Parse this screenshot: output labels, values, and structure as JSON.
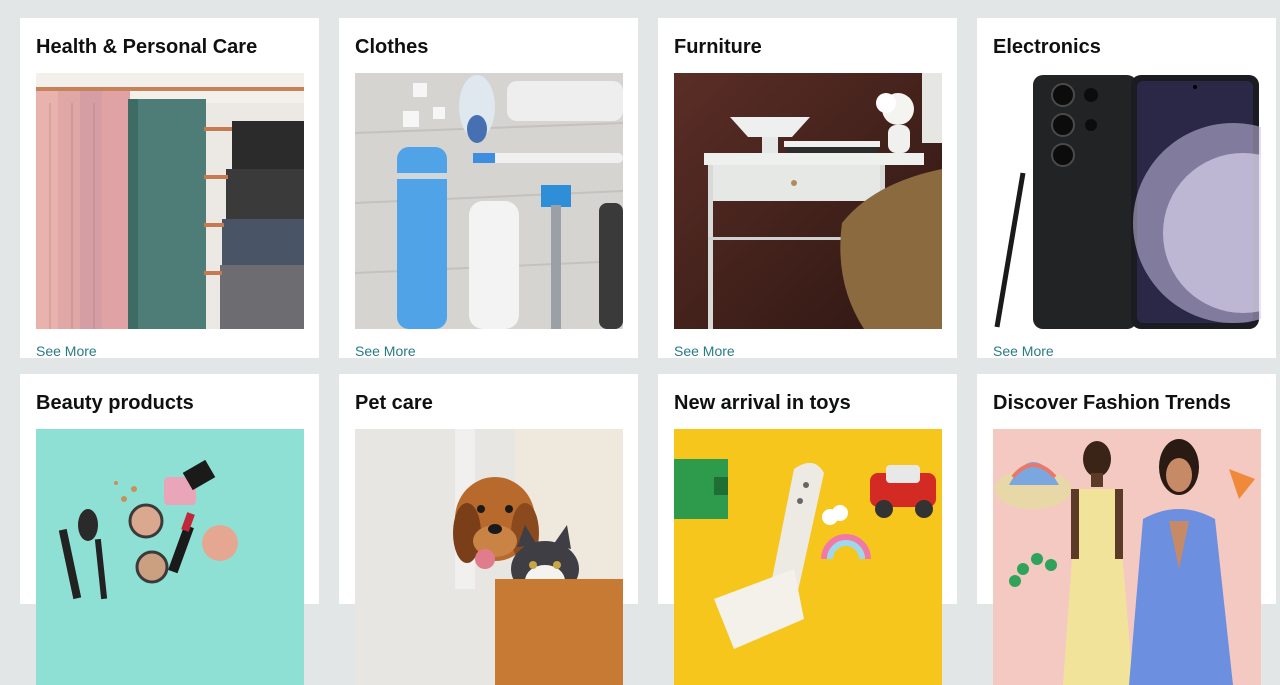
{
  "cards": [
    {
      "title": "Health & Personal Care",
      "link": "See More",
      "image": "towels-on-rack-image"
    },
    {
      "title": "Clothes",
      "link": "See More",
      "image": "toiletries-image"
    },
    {
      "title": "Furniture",
      "link": "See More",
      "image": "desk-chair-image"
    },
    {
      "title": "Electronics",
      "link": "See More",
      "image": "smartphone-image"
    },
    {
      "title": "Beauty products",
      "link": "",
      "image": "makeup-image"
    },
    {
      "title": "Pet care",
      "link": "",
      "image": "dog-and-cat-image"
    },
    {
      "title": "New arrival in toys",
      "link": "",
      "image": "toys-image"
    },
    {
      "title": "Discover Fashion Trends",
      "link": "",
      "image": "fashion-models-image"
    }
  ],
  "colors": {
    "page_bg": "#e3e6e6",
    "card_bg": "#ffffff",
    "link": "#2a7a85",
    "title": "#0f1111"
  }
}
